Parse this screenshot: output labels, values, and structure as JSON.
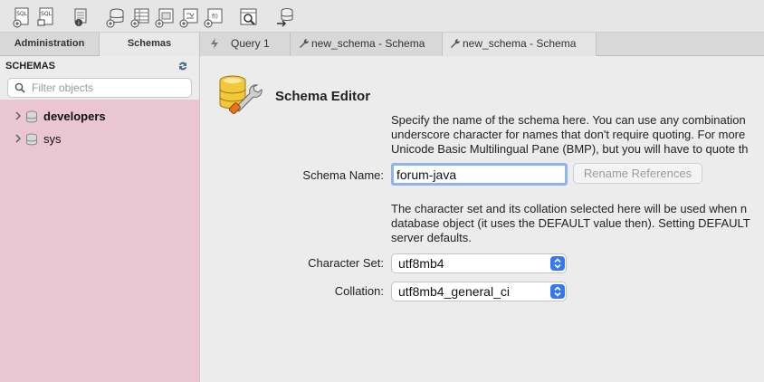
{
  "toolbar": {
    "buttons": [
      {
        "name": "new-sql-tab-icon",
        "glyph": "SQL"
      },
      {
        "name": "open-sql-file-icon",
        "glyph": "SQL"
      },
      {
        "name": "inspector-icon",
        "glyph": "i"
      },
      {
        "name": "create-schema-icon",
        "glyph": ""
      },
      {
        "name": "create-table-icon",
        "glyph": ""
      },
      {
        "name": "create-view-icon",
        "glyph": ""
      },
      {
        "name": "create-procedure-icon",
        "glyph": ""
      },
      {
        "name": "create-function-icon",
        "glyph": "f()"
      },
      {
        "name": "search-table-data-icon",
        "glyph": ""
      },
      {
        "name": "reconnect-icon",
        "glyph": ""
      }
    ]
  },
  "left_tabs": {
    "administration": "Administration",
    "schemas": "Schemas"
  },
  "doc_tabs": [
    {
      "label": "Query 1",
      "icon": "lightning-icon"
    },
    {
      "label": "new_schema - Schema",
      "icon": "wrench-icon"
    },
    {
      "label": "new_schema - Schema",
      "icon": "wrench-icon"
    }
  ],
  "sidebar": {
    "title": "SCHEMAS",
    "filter_placeholder": "Filter objects",
    "schemas": [
      {
        "label": "developers",
        "bold": true
      },
      {
        "label": "sys",
        "bold": false
      }
    ]
  },
  "editor": {
    "title": "Schema Editor",
    "desc1": [
      "Specify the name of the schema here. You can use any combination",
      "underscore character for names that don't require quoting. For more",
      "Unicode Basic Multilingual Pane (BMP), but you will have to quote th"
    ],
    "schema_name_label": "Schema Name:",
    "schema_name_value": "forum-java",
    "rename_button": "Rename References",
    "desc2": [
      "The character set and its collation selected here will be used when n",
      "database object (it uses the DEFAULT value then). Setting DEFAULT",
      "server defaults."
    ],
    "charset_label": "Character Set:",
    "charset_value": "utf8mb4",
    "collation_label": "Collation:",
    "collation_value": "utf8mb4_general_ci"
  },
  "colors": {
    "sidebar_bg": "#e9c6d2",
    "accent": "#3478f6",
    "focus_ring": "#8fb4e6"
  }
}
